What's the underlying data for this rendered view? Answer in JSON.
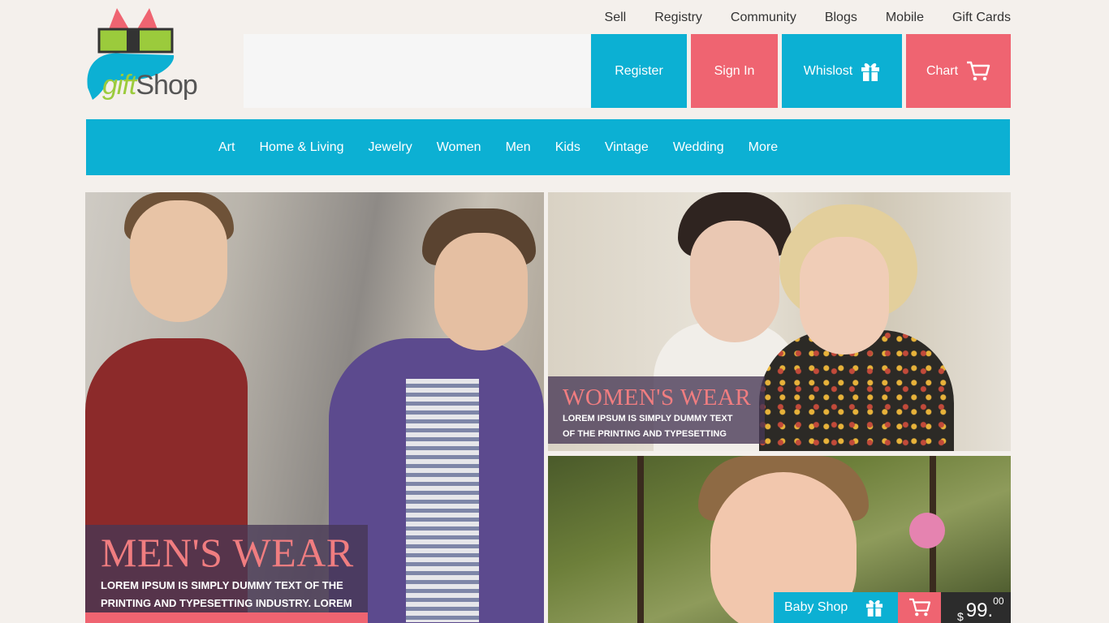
{
  "logo": {
    "gift": "gift",
    "shop": "Shop"
  },
  "topnav": [
    "Sell",
    "Registry",
    "Community",
    "Blogs",
    "Mobile",
    "Gift Cards"
  ],
  "search": {
    "value": "",
    "placeholder": ""
  },
  "header_buttons": {
    "register": "Register",
    "signin": "Sign In",
    "wishlist": "Whislost",
    "cart": "Chart"
  },
  "mainnav": [
    "Art",
    "Home & Living",
    "Jewelry",
    "Women",
    "Men",
    "Kids",
    "Vintage",
    "Wedding",
    "More"
  ],
  "tiles": {
    "women": {
      "title": "WOMEN'S WEAR",
      "line1": "LOREM IPSUM IS SIMPLY DUMMY TEXT",
      "line2": "OF THE PRINTING AND TYPESETTING"
    },
    "men": {
      "title": "MEN'S WEAR",
      "line1": "LOREM IPSUM IS SIMPLY DUMMY TEXT OF THE",
      "line2": "PRINTING AND TYPESETTING INDUSTRY. LOREM"
    },
    "kids": {
      "shop_label": "Baby Shop",
      "currency": "$",
      "price": "99.",
      "price_dec": "00"
    }
  },
  "colors": {
    "cyan": "#0cb0d3",
    "coral": "#ef6471",
    "background": "#f4f0ec",
    "caption_title": "#f07d80"
  },
  "icons": [
    "gift-icon",
    "cart-icon"
  ]
}
